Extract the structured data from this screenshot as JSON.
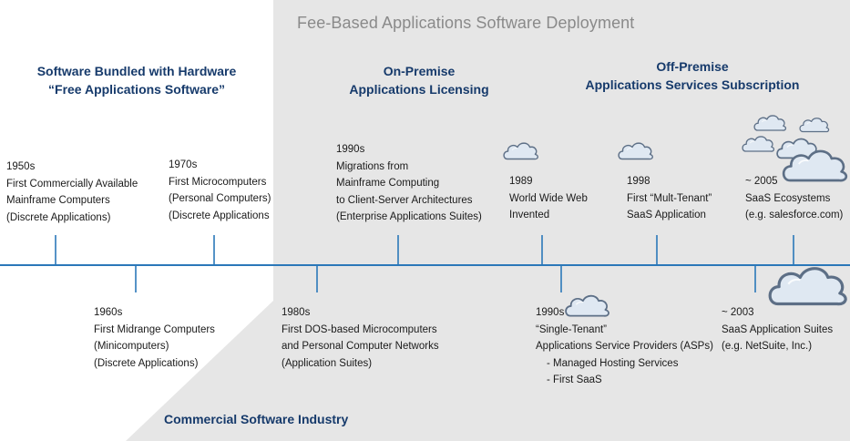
{
  "top_band_title": "Fee-Based Applications Software Deployment",
  "headings": {
    "bundled": [
      "Software Bundled with Hardware",
      "“Free  Applications Software”"
    ],
    "on_premise": [
      "On-Premise",
      "Applications Licensing"
    ],
    "off_premise": [
      "Off-Premise",
      "Applications Services Subscription"
    ]
  },
  "events_above": {
    "e1950s": [
      "1950s",
      "First Commercially Available",
      "Mainframe  Computers",
      "(Discrete Applications)"
    ],
    "e1970s": [
      "1970s",
      "First Microcomputers",
      "(Personal Computers)",
      " (Discrete Applications"
    ],
    "e1990s_migration": [
      "1990s",
      "Migrations from",
      "Mainframe Computing",
      "to Client-Server Architectures",
      "(Enterprise  Applications Suites)"
    ],
    "e1989": [
      "1989",
      "World Wide Web",
      "Invented"
    ],
    "e1998": [
      "1998",
      "First “Mult-Tenant”",
      "SaaS  Application"
    ],
    "e2005": [
      "~ 2005",
      "SaaS Ecosystems",
      "(e.g. salesforce.com)"
    ]
  },
  "events_below": {
    "e1960s": [
      "1960s",
      "First Midrange Computers",
      "(Minicomputers)",
      "(Discrete Applications)"
    ],
    "e1980s": [
      "1980s",
      "First DOS-based Microcomputers",
      "and Personal Computer Networks",
      "(Application Suites)"
    ],
    "e1990s_asp": [
      "1990s",
      "“Single-Tenant”",
      "Applications Service Providers (ASPs)",
      "-  Managed Hosting Services",
      "-  First SaaS"
    ],
    "e2003": [
      "~ 2003",
      " SaaS  Application Suites",
      "(e.g. NetSuite, Inc.)"
    ]
  },
  "footer_label": "Commercial Software Industry",
  "colors": {
    "timeline": "#2b78b9",
    "heading_text": "#163a6b",
    "band_fill": "#e6e6e6",
    "cloud_fill": "#dfe8f2",
    "cloud_stroke": "#5d6f86",
    "title_text": "#8a8a8a"
  },
  "icons": [
    "cloud-icon"
  ]
}
